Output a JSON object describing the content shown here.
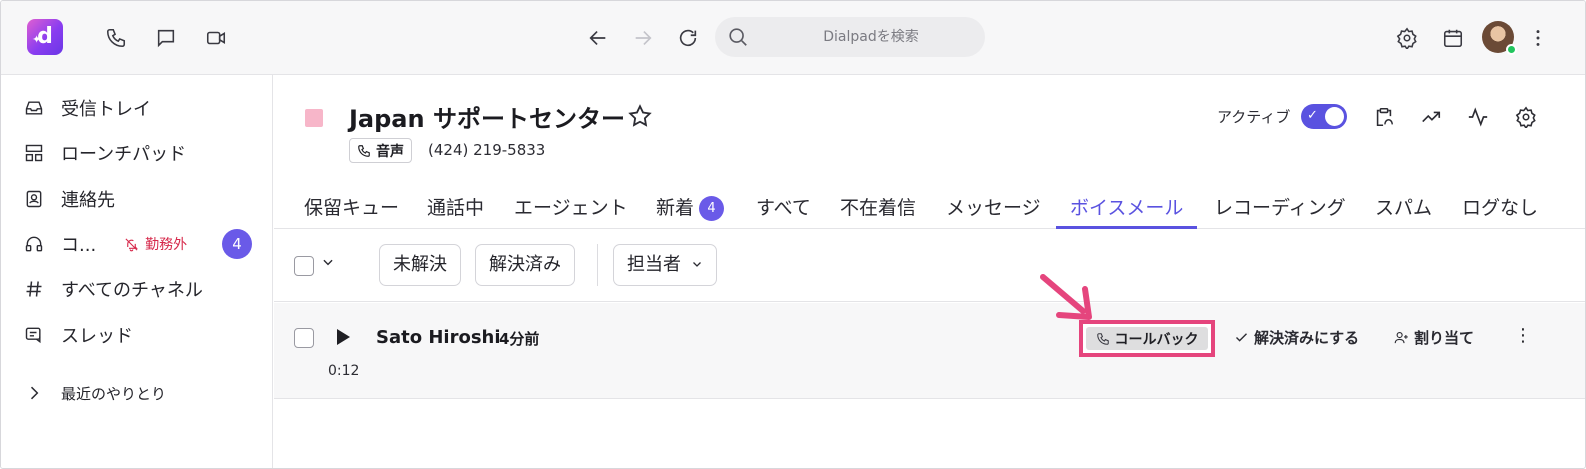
{
  "topbar": {
    "logo_letter": "d",
    "search_placeholder": "Dialpadを検索",
    "icons": [
      "phone-icon",
      "chat-icon",
      "video-icon",
      "back-arrow-icon",
      "forward-arrow-icon",
      "refresh-icon",
      "search-icon",
      "settings-icon",
      "calendar-icon",
      "more-icon"
    ]
  },
  "sidebar": {
    "items": [
      {
        "label": "受信トレイ",
        "icon": "inbox-icon"
      },
      {
        "label": "ローンチパッド",
        "icon": "launchpad-icon"
      },
      {
        "label": "連絡先",
        "icon": "contacts-icon"
      },
      {
        "label": "コ...",
        "icon": "headset-icon",
        "status": "勤務外",
        "badge": "4"
      },
      {
        "label": "すべてのチャネル",
        "icon": "hash-icon"
      },
      {
        "label": "スレッド",
        "icon": "threads-icon"
      }
    ],
    "recent": "最近のやりとり"
  },
  "header": {
    "title": "Japan サポートセンター",
    "channel_tag": "音声",
    "phone": "(424) 219-5833",
    "active_label": "アクティブ",
    "active": true,
    "accent": "#5a52e0"
  },
  "tabs": [
    {
      "label": "保留キュー"
    },
    {
      "label": "通話中"
    },
    {
      "label": "エージェント"
    },
    {
      "label": "新着",
      "badge": "4"
    },
    {
      "label": "すべて"
    },
    {
      "label": "不在着信"
    },
    {
      "label": "メッセージ"
    },
    {
      "label": "ボイスメール",
      "active": true
    },
    {
      "label": "レコーディング"
    },
    {
      "label": "スパム"
    },
    {
      "label": "ログなし"
    }
  ],
  "filters": {
    "unresolved": "未解決",
    "resolved": "解決済み",
    "assignee": "担当者"
  },
  "voicemail": {
    "caller": "Sato Hiroshi",
    "ago": "4分前",
    "duration": "0:12",
    "callback": "コールバック",
    "resolve": "解決済みにする",
    "assign": "割り当て",
    "highlight_color": "#e5457d"
  }
}
